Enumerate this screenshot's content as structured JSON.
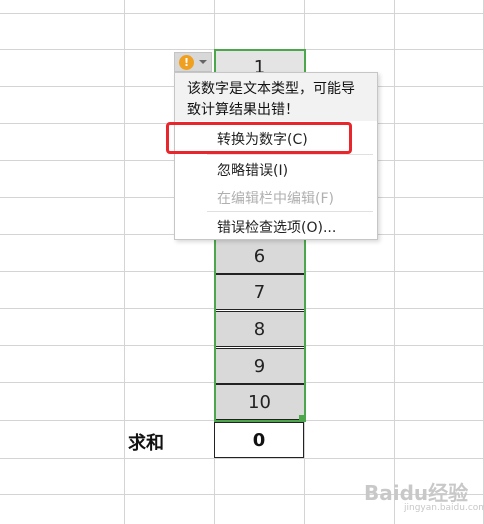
{
  "cells": [
    "1",
    "6",
    "7",
    "8",
    "9",
    "10"
  ],
  "sum": {
    "label": "求和",
    "value": "0"
  },
  "warning": {
    "icon": "exclamation-icon",
    "glyph": "!"
  },
  "menu": {
    "header_line1": "该数字是文本类型，可能导",
    "header_line2": "致计算结果出错！",
    "items": [
      {
        "label": "转换为数字(C)",
        "enabled": true
      },
      {
        "label": "忽略错误(I)",
        "enabled": true
      },
      {
        "label": "在编辑栏中编辑(F)",
        "enabled": false
      },
      {
        "label": "错误检查选项(O)...",
        "enabled": true
      }
    ]
  },
  "colors": {
    "selection": "#4ca64c",
    "highlight": "#e8262c",
    "warning": "#f0a020"
  },
  "watermark": {
    "main": "Baidu经验",
    "sub": "jingyan.baidu.com"
  }
}
